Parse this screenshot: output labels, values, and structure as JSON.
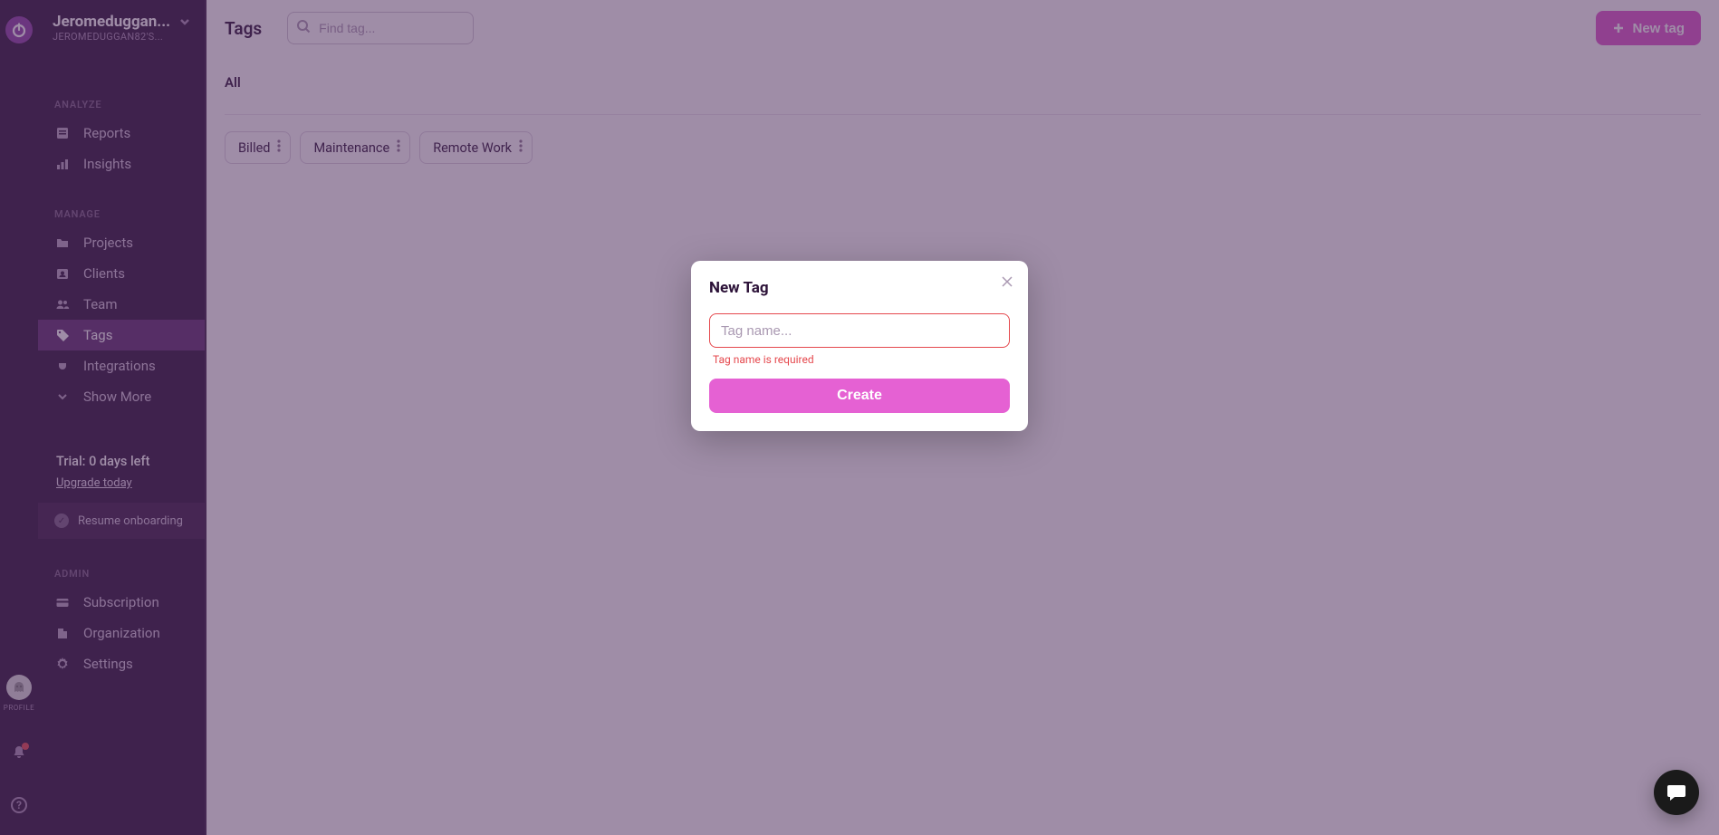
{
  "rail": {
    "profile_caption": "PROFILE"
  },
  "workspace": {
    "name": "Jeromeduggan...",
    "subtitle": "JEROMEDUGGAN82'S..."
  },
  "sidebar": {
    "analyze_heading": "ANALYZE",
    "analyze": {
      "reports": "Reports",
      "insights": "Insights"
    },
    "manage_heading": "MANAGE",
    "manage": {
      "projects": "Projects",
      "clients": "Clients",
      "team": "Team",
      "tags": "Tags",
      "integrations": "Integrations",
      "show_more": "Show More"
    },
    "trial": {
      "line1": "Trial: 0 days left",
      "link": "Upgrade today"
    },
    "resume": "Resume onboarding",
    "admin_heading": "ADMIN",
    "admin": {
      "subscription": "Subscription",
      "organization": "Organization",
      "settings": "Settings"
    }
  },
  "page": {
    "title": "Tags",
    "search_placeholder": "Find tag...",
    "new_tag_button": "New tag",
    "filter_all": "All"
  },
  "tags": [
    {
      "label": "Billed"
    },
    {
      "label": "Maintenance"
    },
    {
      "label": "Remote Work"
    }
  ],
  "modal": {
    "title": "New Tag",
    "input_placeholder": "Tag name...",
    "input_value": "",
    "error": "Tag name is required",
    "submit": "Create"
  },
  "colors": {
    "accent": "#dd54c9",
    "error": "#e5484d",
    "sidebar_bg": "#2c1238"
  }
}
